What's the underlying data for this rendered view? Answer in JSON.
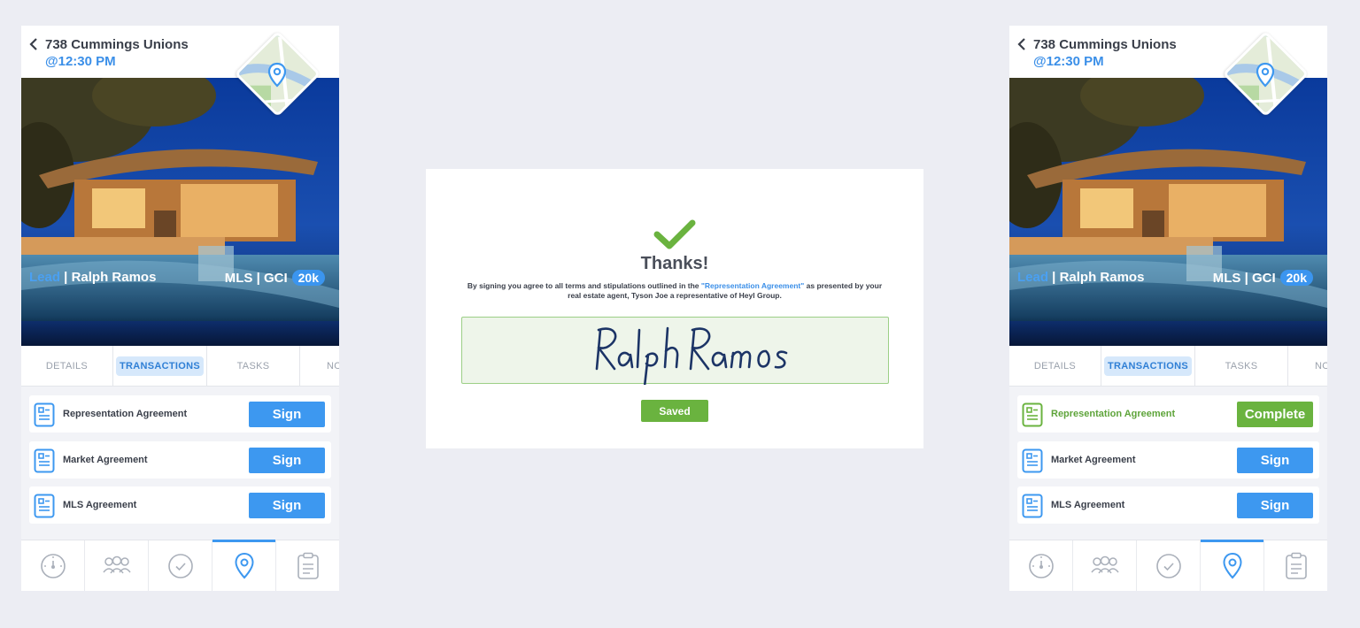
{
  "listing": {
    "address": "738 Cummings Unions",
    "time": "@12:30 PM",
    "lead_label": "Lead",
    "separator": " | ",
    "client_name": "Ralph Ramos",
    "mls_gci_label": "MLS | GCI",
    "gci_value": "20k"
  },
  "tabs": [
    {
      "label": "DETAILS"
    },
    {
      "label": "TRANSACTIONS",
      "active": true
    },
    {
      "label": "TASKS"
    },
    {
      "label": "NO"
    }
  ],
  "documents_left": [
    {
      "label": "Representation Agreement",
      "action": "Sign"
    },
    {
      "label": "Market Agreement",
      "action": "Sign"
    },
    {
      "label": "MLS Agreement",
      "action": "Sign"
    }
  ],
  "documents_right": [
    {
      "label": "Representation Agreement",
      "action": "Complete",
      "status": "complete"
    },
    {
      "label": "Market Agreement",
      "action": "Sign"
    },
    {
      "label": "MLS Agreement",
      "action": "Sign"
    }
  ],
  "nav": [
    {
      "icon": "speedometer-icon"
    },
    {
      "icon": "people-icon"
    },
    {
      "icon": "check-circle-icon"
    },
    {
      "icon": "location-pin-icon",
      "active": true
    },
    {
      "icon": "clipboard-icon"
    }
  ],
  "modal": {
    "title": "Thanks!",
    "terms_before": "By signing you agree to all terms and stipulations outlined in the ",
    "terms_link": "\"Representation Agreement\"",
    "terms_after": " as presented by your real estate agent, Tyson Joe a representative of Heyl Group.",
    "signature": "Ralph Ramos",
    "saved_label": "Saved"
  },
  "colors": {
    "accent_blue": "#3d98f0",
    "complete_green": "#6ab33f",
    "background": "#ecedf3"
  }
}
